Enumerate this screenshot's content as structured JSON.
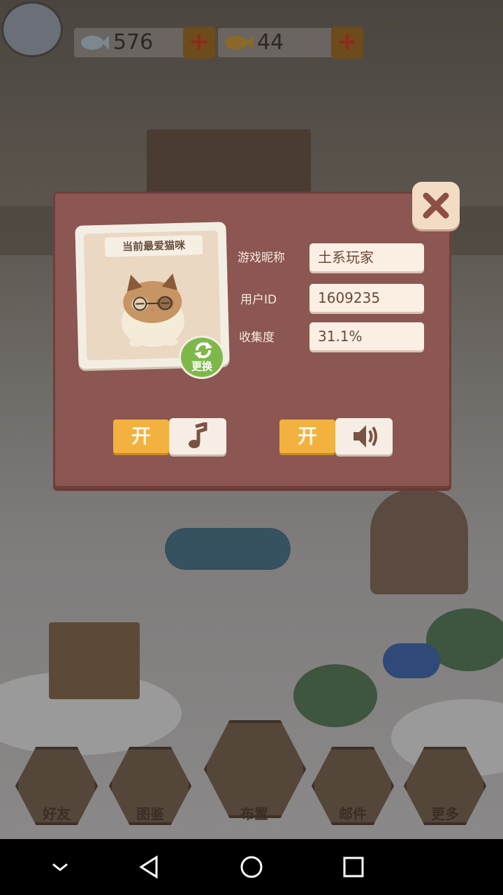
{
  "top_bar": {
    "fish_count": "576",
    "golden_fish_count": "44"
  },
  "dialog": {
    "favorite_cat_title": "当前最爱猫咪",
    "swap_label": "更换",
    "nickname_label": "游戏昵称",
    "nickname_value": "土系玩家",
    "user_id_label": "用户ID",
    "user_id_value": "1609235",
    "collection_label": "收集度",
    "collection_value": "31.1%",
    "music_toggle_label": "开",
    "sound_toggle_label": "开"
  },
  "bottom_menu": [
    {
      "label": "好友"
    },
    {
      "label": "图鉴"
    },
    {
      "label": "布置"
    },
    {
      "label": "邮件"
    },
    {
      "label": "更多"
    }
  ],
  "colors": {
    "dialog_bg": "#8c5652",
    "toggle_on": "#f3b23f",
    "swap_green": "#7fb84a"
  },
  "icons": {
    "close": "close-x-icon",
    "music": "music-note-icon",
    "sound": "speaker-icon",
    "swap": "refresh-icon"
  }
}
